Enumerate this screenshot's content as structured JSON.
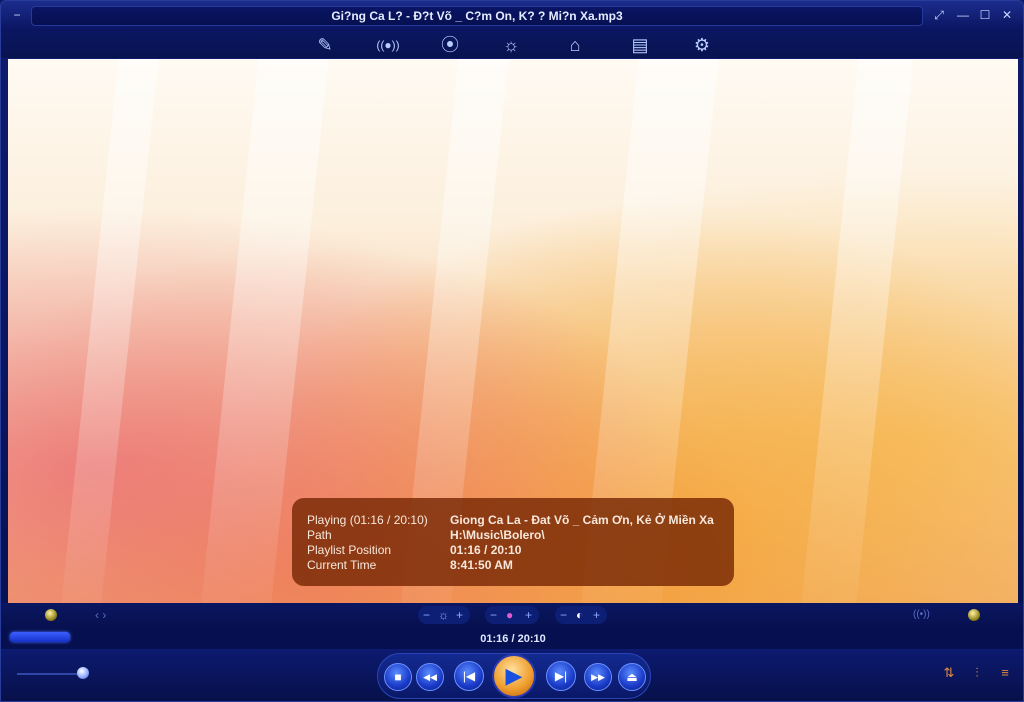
{
  "window": {
    "title": "Gi?ng Ca L? - Đ?t Võ _ C?m On, K? ? Mi?n Xa.mp3",
    "menu_icon": "−",
    "controls": {
      "fullscreen": "⤢",
      "minimize": "—",
      "maximize": "☐",
      "close": "✕"
    }
  },
  "toolbar": {
    "skins": "✎",
    "equalizer": "((●))",
    "visuals": "⦿",
    "effects": "☼",
    "library": "⌂",
    "playlist_editor": "▤",
    "settings": "⚙"
  },
  "osd": {
    "rows": [
      {
        "key": "Playing (01:16 / 20:10)",
        "value": "Giong Ca La - Đat Võ _ Cảm Ơn, Kẻ Ở Miền Xa"
      },
      {
        "key": "Path",
        "value": "H:\\Music\\Bolero\\"
      },
      {
        "key": "Playlist Position",
        "value": "01:16 / 20:10"
      },
      {
        "key": "Current Time",
        "value": "8:41:50 AM"
      }
    ]
  },
  "video_controls": {
    "aspect": "‹ ›",
    "brightness": {
      "minus": "−",
      "icon": "☼",
      "plus": "+"
    },
    "color": {
      "minus": "−",
      "icon": "●",
      "plus": "+"
    },
    "contrast": {
      "minus": "−",
      "icon": "◐",
      "plus": "+"
    },
    "audio": "((•))"
  },
  "seek": {
    "time_display": "01:16 / 20:10",
    "progress_fraction": 0.063
  },
  "volume": {
    "level_fraction": 0.95
  },
  "transport": {
    "stop": "■",
    "rewind": "◀◀",
    "previous": "|◀",
    "play": "▶",
    "next": "▶|",
    "forward": "▶▶",
    "open": "⏏"
  },
  "right_controls": {
    "sort": "⇅",
    "equalizer": "⫶",
    "playlist": "≡"
  },
  "colors": {
    "accent": "#1a3ac8",
    "play_button": "#f0a030",
    "osd_bg": "#782805"
  }
}
